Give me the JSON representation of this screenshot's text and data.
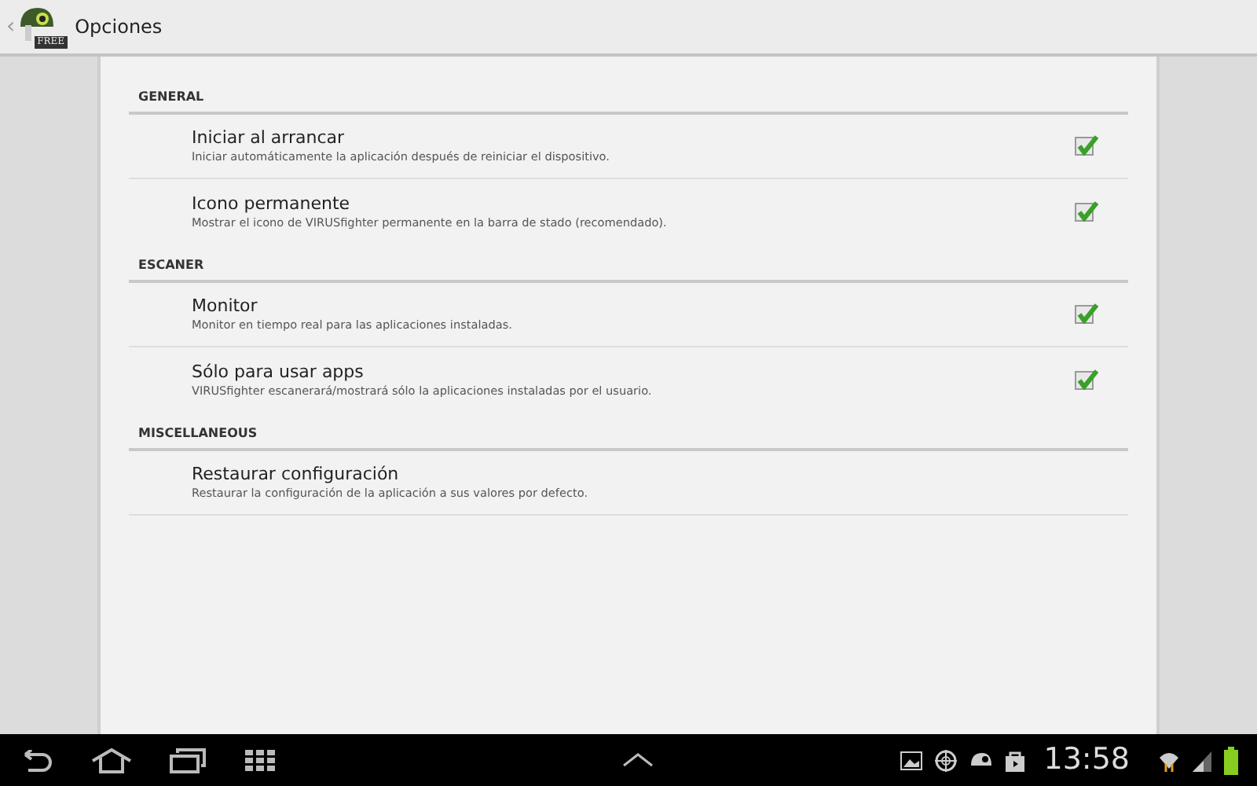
{
  "action_bar": {
    "back": "‹",
    "logo_badge": "FREE",
    "title": "Opciones"
  },
  "sections": [
    {
      "heading": "GENERAL",
      "items": [
        {
          "kind": "checkbox",
          "title": "Iniciar al arrancar",
          "summary": "Iniciar automáticamente la aplicación después de reiniciar el dispositivo.",
          "checked": true
        },
        {
          "kind": "checkbox",
          "title": "Icono permanente",
          "summary": "Mostrar el icono de VIRUSfighter permanente en la barra de stado (recomendado).",
          "checked": true
        }
      ]
    },
    {
      "heading": "ESCANER",
      "items": [
        {
          "kind": "checkbox",
          "title": "Monitor",
          "summary": "Monitor en tiempo real para las aplicaciones instaladas.",
          "checked": true
        },
        {
          "kind": "checkbox",
          "title": "Sólo para usar apps",
          "summary": "VIRUSfighter escanerará/mostrará sólo la aplicaciones instaladas por el usuario.",
          "checked": true
        }
      ]
    },
    {
      "heading": "MISCELLANEOUS",
      "items": [
        {
          "kind": "action",
          "title": "Restaurar configuración",
          "summary": "Restaurar la configuración de la aplicación a sus valores por defecto."
        }
      ]
    }
  ],
  "system_bar": {
    "time": "13:58"
  }
}
